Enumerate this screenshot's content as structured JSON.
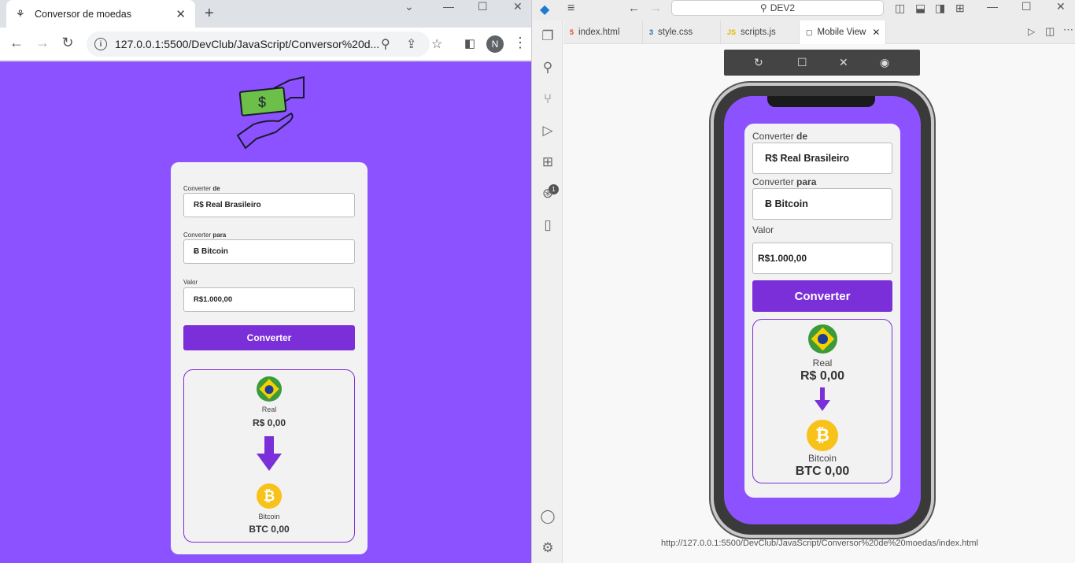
{
  "browser": {
    "tab_title": "Conversor de moedas",
    "url": "127.0.0.1:5500/DevClub/JavaScript/Conversor%20d...",
    "profile_initial": "N"
  },
  "app": {
    "from_label": "Converter",
    "from_label_bold": "de",
    "to_label": "Converter",
    "to_label_bold": "para",
    "from_value": "R$ Real Brasileiro",
    "to_value": "Ƀ Bitcoin",
    "amount_label": "Valor",
    "amount_value": "R$1.000,00",
    "convert_button": "Converter",
    "from_currency_name": "Real",
    "from_currency_value": "R$ 0,00",
    "to_currency_name": "Bitcoin",
    "to_currency_value": "BTC 0,00",
    "bitcoin_symbol": "₿"
  },
  "vscode": {
    "search": "DEV2",
    "tabs": [
      {
        "label": "index.html",
        "icon": "html-icon",
        "color": "#e44d26"
      },
      {
        "label": "style.css",
        "icon": "css-icon",
        "color": "#1572b6"
      },
      {
        "label": "scripts.js",
        "icon": "js-icon",
        "color": "#e8b600"
      },
      {
        "label": "Mobile View",
        "icon": "preview-icon",
        "color": "#888"
      }
    ],
    "extensions_badge": "1",
    "preview_url": "http://127.0.0.1:5500/DevClub/JavaScript/Conversor%20de%20moedas/index.html"
  },
  "colors": {
    "background": "#8c52ff",
    "button": "#7b2fd8",
    "card": "#f2f2f2"
  }
}
